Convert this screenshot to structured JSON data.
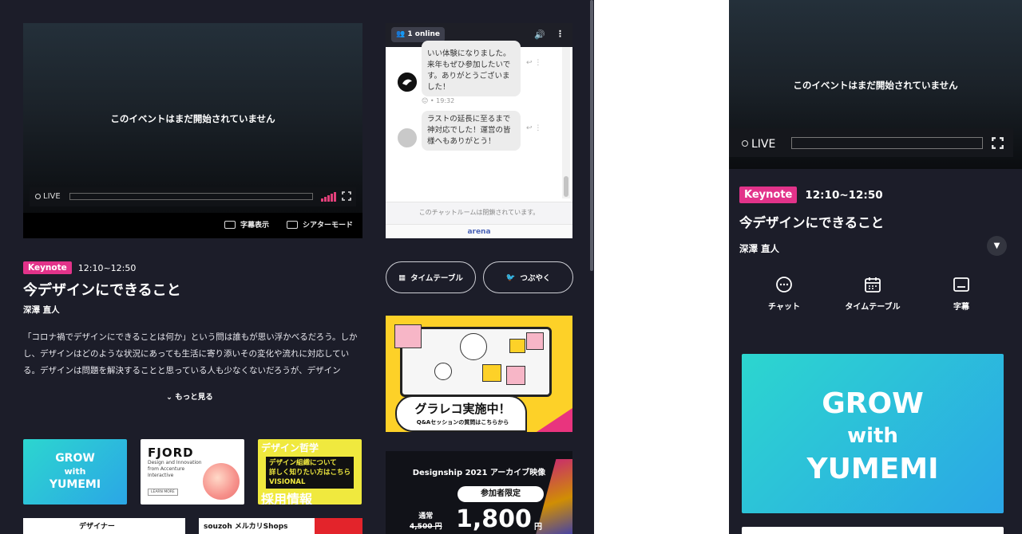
{
  "desktop": {
    "player": {
      "status": "このイベントはまだ開始されていません",
      "live_label": "LIVE",
      "subtitles_label": "字幕表示",
      "theater_label": "シアターモード"
    },
    "chat": {
      "online_count": "1",
      "online_label": "online",
      "messages": [
        {
          "text": "いい体験になりました。来年もぜひ参加したいです。ありがとうございました！",
          "partial_top": "…",
          "time": "19:32"
        },
        {
          "text": "ラストの延長に至るまで神対応でした！運営の皆様へもありがとう！"
        }
      ],
      "closed_notice": "このチャットルームは閉鎖されています。",
      "brand": "arena"
    },
    "actions": {
      "timetable": "タイムテーブル",
      "tweet": "つぶやく"
    },
    "session": {
      "tag": "Keynote",
      "time": "12:10~12:50",
      "title": "今デザインにできること",
      "speaker": "深澤 直人",
      "description": "「コロナ禍でデザインにできることは何か」という問は誰もが思い浮かべるだろう。しかし、デザインはどのような状況にあっても生活に寄り添いその変化や流れに対応している。デザインは問題を解決することと思っている人も少なくないだろうが、デザイン",
      "more": "もっと見る"
    },
    "sponsors": {
      "grow": [
        "GROW",
        "with",
        "YUMEMI"
      ],
      "fjord": {
        "name": "FJORD",
        "sub": "Design and Innovation from Accenture Interactive",
        "cta": "LEARN MORE"
      },
      "visional": {
        "lines": [
          "デザイン組織について",
          "詳しく知りたい方はこちら"
        ],
        "brand": "VISIONAL",
        "top": "デザイン哲学",
        "bottom": "採用情報"
      },
      "row2_a": "デザイナー",
      "row2_b": "souzoh メルカリShops"
    },
    "graphic_banner": {
      "title": "グラレコ実施中！",
      "sub": "Q&Aセッションの質問はこちらから"
    },
    "archive": {
      "title": "Designship 2021 アーカイブ映像",
      "badge": "参加者限定",
      "normal_label": "通常",
      "normal_price": "4,500 円",
      "price": "1,800",
      "yen": "円"
    }
  },
  "mobile": {
    "status": "このイベントはまだ開始されていません",
    "live_label": "LIVE",
    "tag": "Keynote",
    "time": "12:10~12:50",
    "title": "今デザインにできること",
    "speaker": "深澤 直人",
    "tabs": [
      "チャット",
      "タイムテーブル",
      "字幕"
    ],
    "banner": [
      "GROW",
      "with",
      "YUMEMI"
    ]
  },
  "colors": {
    "background": "#1c1d29",
    "accent": "#e2338a",
    "signal": "#e2407a"
  }
}
